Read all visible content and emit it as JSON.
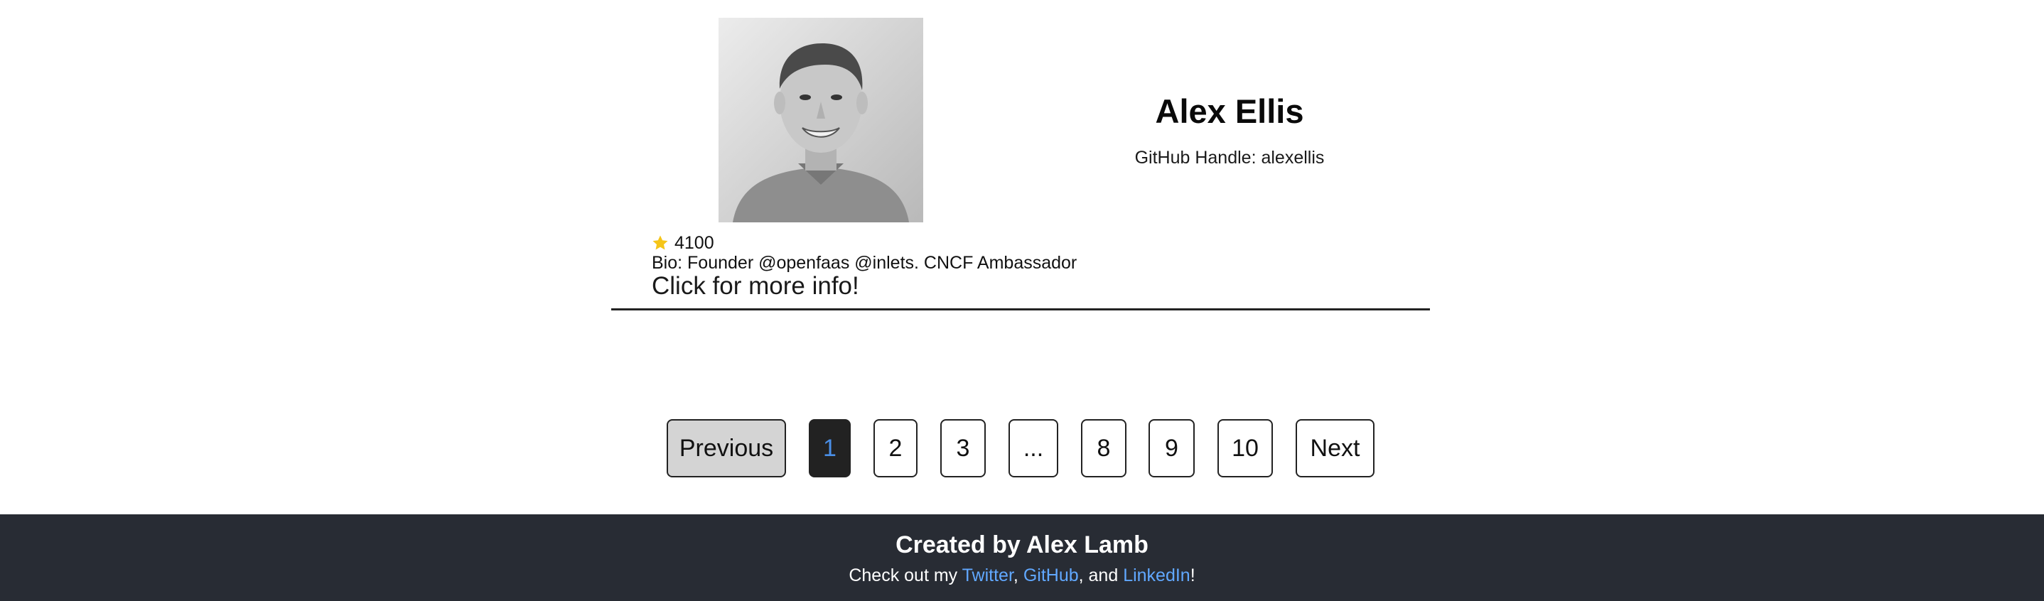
{
  "profile": {
    "name": "Alex Ellis",
    "handle_line": "GitHub Handle: alexellis",
    "stars": "4100",
    "bio_line": "Bio: Founder @openfaas @inlets. CNCF Ambassador",
    "more_info": "Click for more info!",
    "icons": {
      "avatar": "avatar-photo",
      "stars": "star-icon"
    },
    "colors": {
      "star": "#f5c518"
    }
  },
  "pagination": {
    "previous_label": "Previous",
    "next_label": "Next",
    "pages": [
      "1",
      "2",
      "3",
      "...",
      "8",
      "9",
      "10"
    ],
    "current_page": "1",
    "colors": {
      "active_bg": "#222222",
      "active_text": "#4a8fe7",
      "previous_bg": "#d4d4d4"
    }
  },
  "footer": {
    "title": "Created by Alex Lamb",
    "text_prefix": "Check out my ",
    "twitter_label": "Twitter",
    "sep1": ", ",
    "github_label": "GitHub",
    "sep2": ", and ",
    "linkedin_label": "LinkedIn",
    "text_suffix": "!",
    "colors": {
      "background": "#282c34",
      "link": "#61a8ff"
    }
  }
}
